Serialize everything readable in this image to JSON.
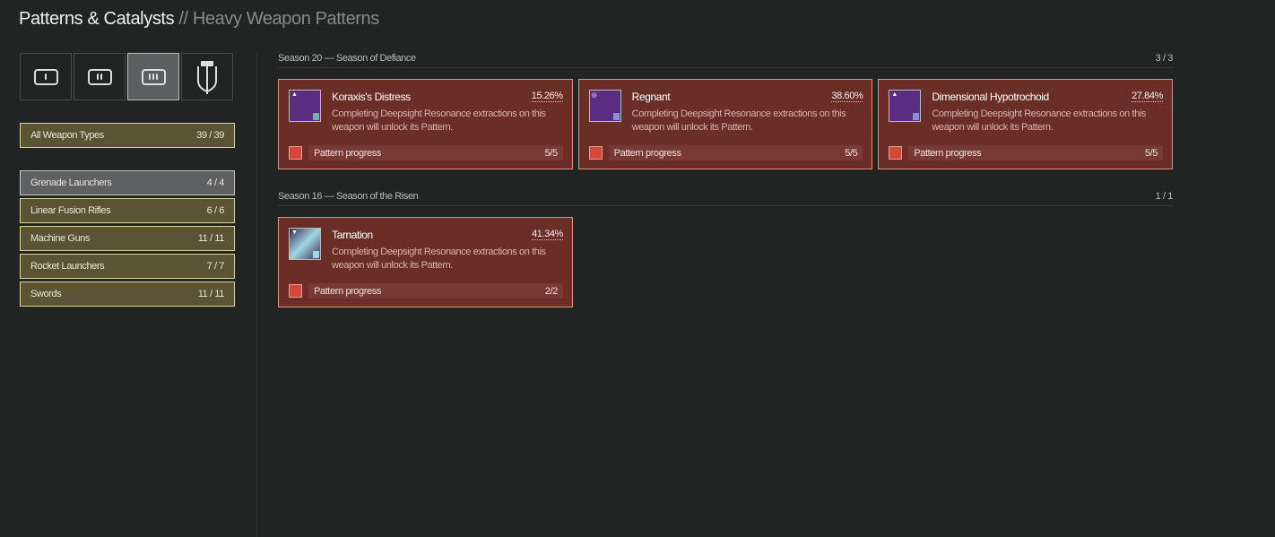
{
  "header": {
    "title": "Patterns & Catalysts",
    "separator": "//",
    "subtitle": "Heavy Weapon Patterns"
  },
  "ammo_tabs": [
    {
      "name": "primary"
    },
    {
      "name": "special"
    },
    {
      "name": "heavy",
      "active": true
    },
    {
      "name": "exotic-catalysts"
    }
  ],
  "sidebar": {
    "all": {
      "label": "All Weapon Types",
      "count": "39 / 39"
    },
    "items": [
      {
        "label": "Grenade Launchers",
        "count": "4 / 4"
      },
      {
        "label": "Linear Fusion Rifles",
        "count": "6 / 6"
      },
      {
        "label": "Machine Guns",
        "count": "11 / 11"
      },
      {
        "label": "Rocket Launchers",
        "count": "7 / 7"
      },
      {
        "label": "Swords",
        "count": "11 / 11"
      }
    ]
  },
  "sections": [
    {
      "title": "Season 20 — Season of Defiance",
      "count": "3 / 3",
      "cards": [
        {
          "name": "Koraxis's Distress",
          "pct": "15.26%",
          "desc": "Completing Deepsight Resonance extractions on this weapon will unlock its Pattern.",
          "progress_label": "Pattern progress",
          "progress": "5/5"
        },
        {
          "name": "Regnant",
          "pct": "38.60%",
          "desc": "Completing Deepsight Resonance extractions on this weapon will unlock its Pattern.",
          "progress_label": "Pattern progress",
          "progress": "5/5"
        },
        {
          "name": "Dimensional Hypotrochoid",
          "pct": "27.84%",
          "desc": "Completing Deepsight Resonance extractions on this weapon will unlock its Pattern.",
          "progress_label": "Pattern progress",
          "progress": "5/5"
        }
      ]
    },
    {
      "title": "Season 16 — Season of the Risen",
      "count": "1 / 1",
      "cards": [
        {
          "name": "Tarnation",
          "pct": "41.34%",
          "desc": "Completing Deepsight Resonance extractions on this weapon will unlock its Pattern.",
          "progress_label": "Pattern progress",
          "progress": "2/2"
        }
      ]
    }
  ]
}
